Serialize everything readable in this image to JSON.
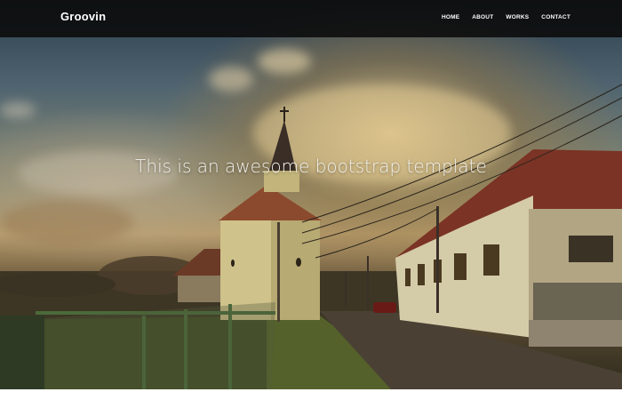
{
  "brand": {
    "name": "Groovin"
  },
  "nav": {
    "items": [
      {
        "label": "HOME"
      },
      {
        "label": "ABOUT"
      },
      {
        "label": "WORKS"
      },
      {
        "label": "CONTACT"
      }
    ]
  },
  "hero": {
    "headline": "This is an awesome bootstrap template"
  },
  "colors": {
    "topbar_bg": "#0a0a0a",
    "text": "#ffffff"
  }
}
